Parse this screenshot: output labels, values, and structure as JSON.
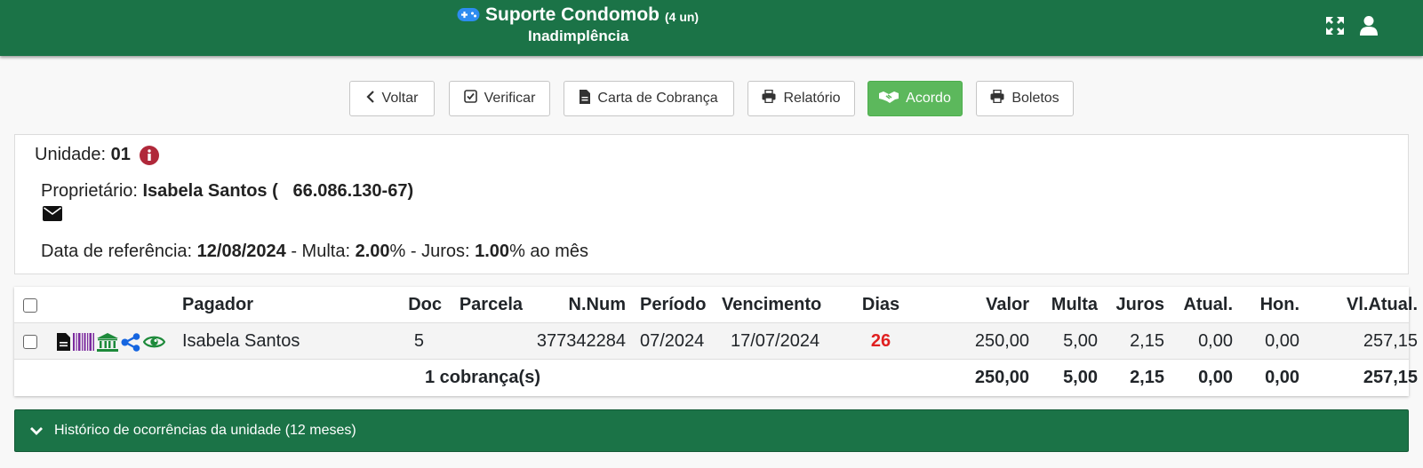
{
  "header": {
    "app_name": "Suporte Condomob",
    "unit_count": "(4 un)",
    "subtitle": "Inadimplência",
    "icons": [
      "gamepad-icon",
      "expand-icon",
      "user-icon"
    ]
  },
  "toolbar": {
    "back": "Voltar",
    "verify": "Verificar",
    "letter": "Carta de Cobrança",
    "report": "Relatório",
    "agreement": "Acordo",
    "slips": "Boletos"
  },
  "unit": {
    "label": "Unidade:",
    "value": "01",
    "owner_label": "Proprietário:",
    "owner_name": "Isabela Santos (",
    "owner_doc": "66.086.130-67)",
    "ref_label": "Data de referência:",
    "ref_date": "12/08/2024",
    "fine_label": "- Multa:",
    "fine_value": "2.00",
    "interest_label": "% - Juros:",
    "interest_value": "1.00",
    "interest_suffix": "% ao mês"
  },
  "table": {
    "headers": {
      "payer": "Pagador",
      "doc": "Doc",
      "installment": "Parcela",
      "number": "N.Num",
      "period": "Período",
      "due": "Vencimento",
      "days": "Dias",
      "value": "Valor",
      "fine": "Multa",
      "interest": "Juros",
      "update": "Atual.",
      "fees": "Hon.",
      "updated_value": "Vl.Atual."
    },
    "row": {
      "payer": "Isabela Santos",
      "doc": "5",
      "installment": "",
      "number": "377342284",
      "period": "07/2024",
      "due": "17/07/2024",
      "days": "26",
      "value": "250,00",
      "fine": "5,00",
      "interest": "2,15",
      "update": "0,00",
      "fees": "0,00",
      "updated_value": "257,15"
    },
    "totals": {
      "count": "1 cobrança(s)",
      "value": "250,00",
      "fine": "5,00",
      "interest": "2,15",
      "update": "0,00",
      "fees": "0,00",
      "updated_value": "257,15"
    },
    "colors": {
      "days_overdue": "#e02020"
    }
  },
  "history": {
    "label": "Histórico de ocorrências da unidade (12 meses)"
  },
  "colors": {
    "header_bg": "#1b7347",
    "accent_green": "#5cb85c"
  }
}
